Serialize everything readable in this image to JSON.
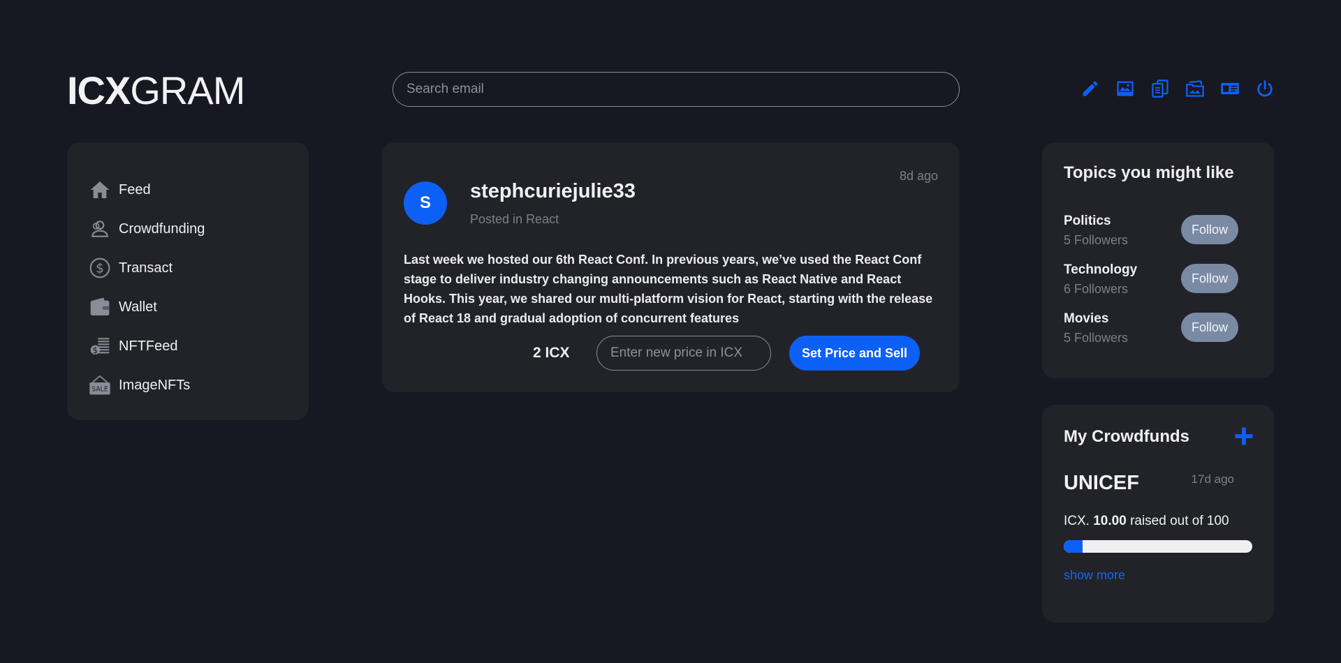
{
  "brand": {
    "bold": "ICX",
    "light": "GRAM"
  },
  "search": {
    "placeholder": "Search email"
  },
  "toolbar": {
    "icons": [
      "pencil-icon",
      "image-icon",
      "documents-icon",
      "folder-image-icon",
      "id-card-icon",
      "power-icon"
    ],
    "accent": "#0d60f5"
  },
  "sidebar": {
    "items": [
      {
        "label": "Feed",
        "icon": "home-icon"
      },
      {
        "label": "Crowdfunding",
        "icon": "people-icon"
      },
      {
        "label": "Transact",
        "icon": "dollar-circle-icon"
      },
      {
        "label": "Wallet",
        "icon": "wallet-icon"
      },
      {
        "label": "NFTFeed",
        "icon": "nft-coins-icon"
      },
      {
        "label": "ImageNFTs",
        "icon": "sale-sign-icon"
      }
    ]
  },
  "post": {
    "avatar_letter": "S",
    "username": "stephcuriejulie33",
    "posted_prefix": "Posted in",
    "topic": "React",
    "time": "8d ago",
    "body": "Last week we hosted our 6th React Conf. In previous years, we’ve used the React Conf stage to deliver industry changing announcements such as React Native and React Hooks. This year, we shared our multi-platform vision for React, starting with the release of React 18 and gradual adoption of concurrent features",
    "price": "2 ICX",
    "price_placeholder": "Enter new price in ICX",
    "sell_label": "Set Price and Sell"
  },
  "topics": {
    "title": "Topics you might like",
    "follow_label": "Follow",
    "items": [
      {
        "name": "Politics",
        "followers": "5 Followers"
      },
      {
        "name": "Technology",
        "followers": "6 Followers"
      },
      {
        "name": "Movies",
        "followers": "5 Followers"
      }
    ]
  },
  "crowdfunds": {
    "title": "My Crowdfunds",
    "name": "UNICEF",
    "time": "17d ago",
    "raised_prefix": "ICX.",
    "raised_amount": "10.00",
    "raised_suffix": "raised out of 100",
    "progress_percent": 10,
    "show_more": "show more"
  }
}
